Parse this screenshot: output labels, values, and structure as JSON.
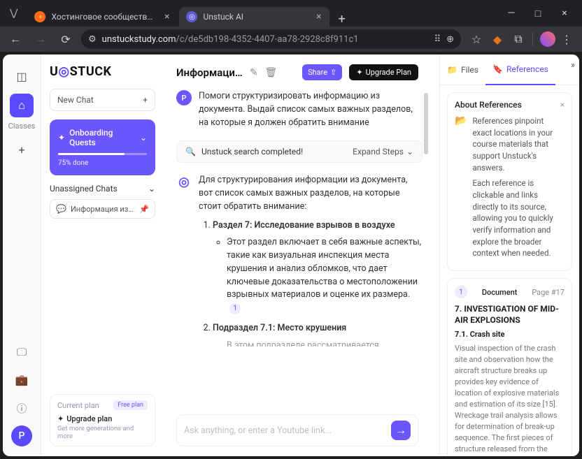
{
  "browser": {
    "tabs": [
      {
        "title": "Хостинговое сообщество «Tim"
      },
      {
        "title": "Unstuck AI"
      }
    ],
    "url_domain": "unstuckstudy.com",
    "url_path": "/c/de5db198-4352-4407-aa78-2928c8f911c1"
  },
  "rail": {
    "classes_label": "Classes"
  },
  "sidebar": {
    "logo": "UNSTUCK",
    "new_chat": "New Chat",
    "onboarding": {
      "title": "Onboarding Quests",
      "pct": "75% done"
    },
    "unassigned_header": "Unassigned Chats",
    "chat_item": "Информация из доку…",
    "plan": {
      "current": "Current plan",
      "badge": "Free plan",
      "upgrade": "Upgrade plan",
      "sub": "Get more generations and more"
    }
  },
  "main": {
    "doc_title": "Информаци…",
    "share": "Share",
    "upgrade": "Upgrade Plan",
    "user_msg": "Помоги структуризировать информацию из документа. Выдай список самых важных разделов, на которые я должен обратить внимание",
    "search_status": "Unstuck search completed!",
    "expand_steps": "Expand Steps",
    "intro": "Для структурирования информации из документа, вот список самых важных разделов, на которые стоит обратить внимание:",
    "sections": [
      {
        "title": "Раздел 7: Исследование взрывов в воздухе",
        "bullet": "Этот раздел включает в себя важные аспекты, такие как визуальная инспекция места крушения и анализ обломков, что дает ключевые доказательства о местоположении взрывных материалов и оценке их размера.",
        "ref": "1"
      },
      {
        "title": "Подраздел 7.1: Место крушения",
        "bullet": "В этом подразделе рассматривается"
      }
    ],
    "input_placeholder": "Ask anything, or enter a Youtube link..."
  },
  "right": {
    "tabs": {
      "files": "Files",
      "references": "References"
    },
    "about": {
      "title": "About References",
      "p1": "References pinpoint exact locations in your course materials that support Unstuck's answers.",
      "p2": "Each reference is clickable and links directly to its source, allowing you to quickly verify information and explore the broader context when needed."
    },
    "ref": {
      "num": "1",
      "doc": "Document",
      "page": "Page #17",
      "heading": "7. INVESTIGATION OF MID-AIR EXPLOSIONS",
      "subheading": "7.1. Crash site",
      "body": "Visual inspection of the crash site and observation how the aircraft structure breaks up provides key evidence of location of explosive materials and estimation of its size [15]. Wreckage trail analysis allows for determination of break-up sequence. The first pieces of structure released from the"
    }
  }
}
